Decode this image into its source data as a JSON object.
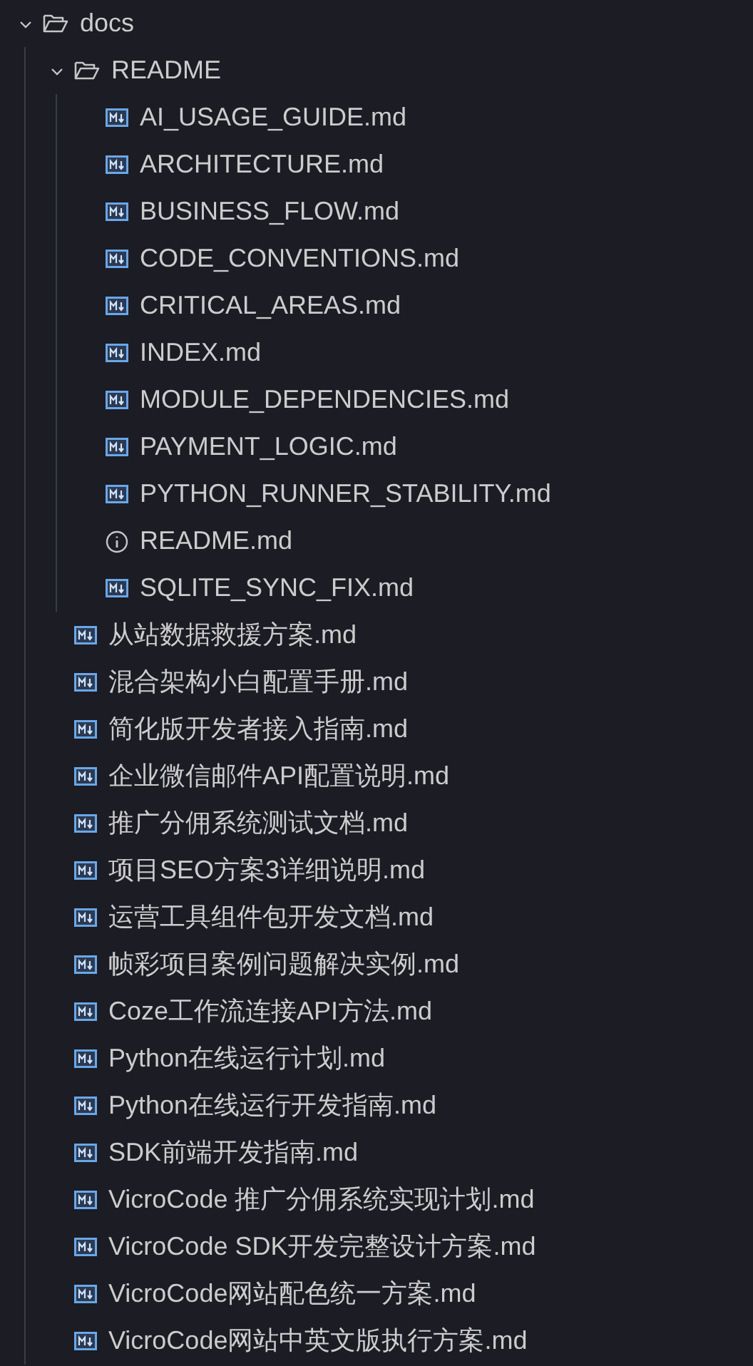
{
  "tree": [
    {
      "name": "docs",
      "kind": "folder",
      "expanded": true,
      "children": [
        {
          "name": "README",
          "kind": "folder",
          "expanded": true,
          "children": [
            {
              "name": "AI_USAGE_GUIDE.md",
              "kind": "markdown"
            },
            {
              "name": "ARCHITECTURE.md",
              "kind": "markdown"
            },
            {
              "name": "BUSINESS_FLOW.md",
              "kind": "markdown"
            },
            {
              "name": "CODE_CONVENTIONS.md",
              "kind": "markdown"
            },
            {
              "name": "CRITICAL_AREAS.md",
              "kind": "markdown"
            },
            {
              "name": "INDEX.md",
              "kind": "markdown"
            },
            {
              "name": "MODULE_DEPENDENCIES.md",
              "kind": "markdown"
            },
            {
              "name": "PAYMENT_LOGIC.md",
              "kind": "markdown"
            },
            {
              "name": "PYTHON_RUNNER_STABILITY.md",
              "kind": "markdown"
            },
            {
              "name": "README.md",
              "kind": "info"
            },
            {
              "name": "SQLITE_SYNC_FIX.md",
              "kind": "markdown"
            }
          ]
        },
        {
          "name": "从站数据救援方案.md",
          "kind": "markdown"
        },
        {
          "name": "混合架构小白配置手册.md",
          "kind": "markdown"
        },
        {
          "name": "简化版开发者接入指南.md",
          "kind": "markdown"
        },
        {
          "name": "企业微信邮件API配置说明.md",
          "kind": "markdown"
        },
        {
          "name": "推广分佣系统测试文档.md",
          "kind": "markdown"
        },
        {
          "name": "项目SEO方案3详细说明.md",
          "kind": "markdown"
        },
        {
          "name": "运营工具组件包开发文档.md",
          "kind": "markdown"
        },
        {
          "name": "帧彩项目案例问题解决实例.md",
          "kind": "markdown"
        },
        {
          "name": "Coze工作流连接API方法.md",
          "kind": "markdown"
        },
        {
          "name": "Python在线运行计划.md",
          "kind": "markdown"
        },
        {
          "name": "Python在线运行开发指南.md",
          "kind": "markdown"
        },
        {
          "name": "SDK前端开发指南.md",
          "kind": "markdown"
        },
        {
          "name": "VicroCode 推广分佣系统实现计划.md",
          "kind": "markdown"
        },
        {
          "name": "VicroCode SDK开发完整设计方案.md",
          "kind": "markdown"
        },
        {
          "name": "VicroCode网站配色统一方案.md",
          "kind": "markdown"
        },
        {
          "name": "VicroCode网站中英文版执行方案.md",
          "kind": "markdown"
        }
      ]
    }
  ]
}
